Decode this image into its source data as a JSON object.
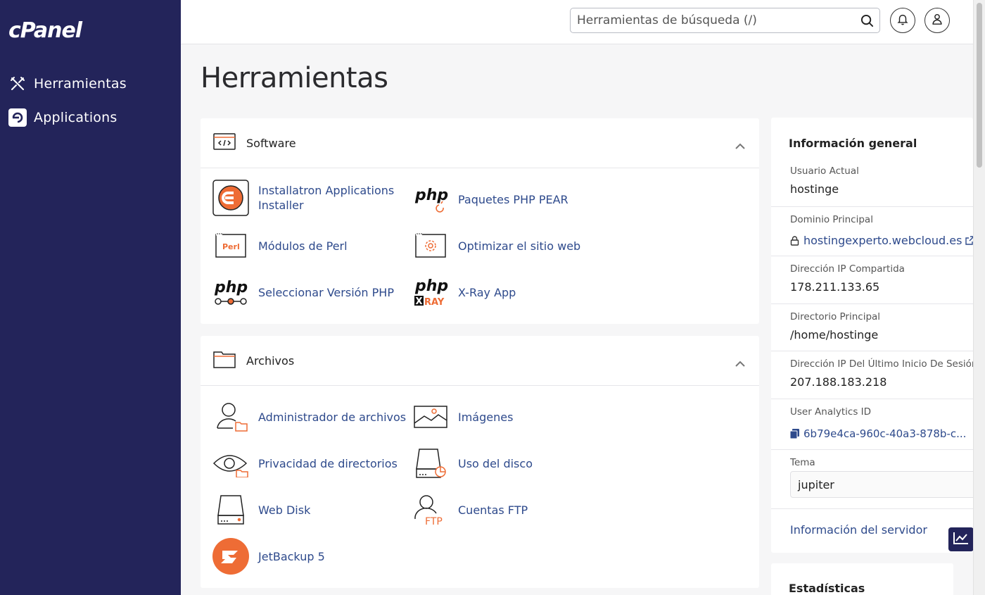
{
  "sidebar": {
    "logo": "cPanel",
    "items": [
      {
        "label": "Herramientas",
        "icon": "tools-icon"
      },
      {
        "label": "Applications",
        "icon": "applications-icon"
      }
    ]
  },
  "header": {
    "search_placeholder": "Herramientas de búsqueda (/)"
  },
  "page": {
    "title": "Herramientas"
  },
  "software": {
    "title": "Software",
    "items": [
      {
        "label_line1": "Installatron Applications",
        "label_line2": "Installer"
      },
      {
        "label": "Paquetes PHP PEAR"
      },
      {
        "label": "Módulos de Perl",
        "icon_text": "Perl"
      },
      {
        "label": "Optimizar el sitio web"
      },
      {
        "label": "Seleccionar Versión PHP",
        "icon_text": "php"
      },
      {
        "label": "X-Ray App",
        "icon_text": "php",
        "icon_subtext": "XRAY"
      }
    ]
  },
  "archivos": {
    "title": "Archivos",
    "items": [
      {
        "label": "Administrador de archivos"
      },
      {
        "label": "Imágenes"
      },
      {
        "label": "Privacidad de directorios"
      },
      {
        "label": "Uso del disco"
      },
      {
        "label": "Web Disk"
      },
      {
        "label": "Cuentas FTP",
        "icon_text": "FTP"
      },
      {
        "label": "JetBackup 5"
      }
    ]
  },
  "info": {
    "title": "Información general",
    "usuario_label": "Usuario Actual",
    "usuario_value": "hostinge",
    "dominio_label": "Dominio Principal",
    "dominio_value": "hostingexperto.webcloud.es",
    "ip_label": "Dirección IP Compartida",
    "ip_value": "178.211.133.65",
    "dir_label": "Directorio Principal",
    "dir_value": "/home/hostinge",
    "last_ip_label": "Dirección IP Del Último Inicio De Sesión",
    "last_ip_value": "207.188.183.218",
    "analytics_label": "User Analytics ID",
    "analytics_value": "6b79e4ca-960c-40a3-878b-c...",
    "tema_label": "Tema",
    "tema_value": "jupiter",
    "server_link": "Información del servidor"
  },
  "stats": {
    "title": "Estadísticas"
  },
  "colors": {
    "sidebar": "#23245a",
    "link": "#2e4a8c",
    "accent": "#ee6c35"
  }
}
